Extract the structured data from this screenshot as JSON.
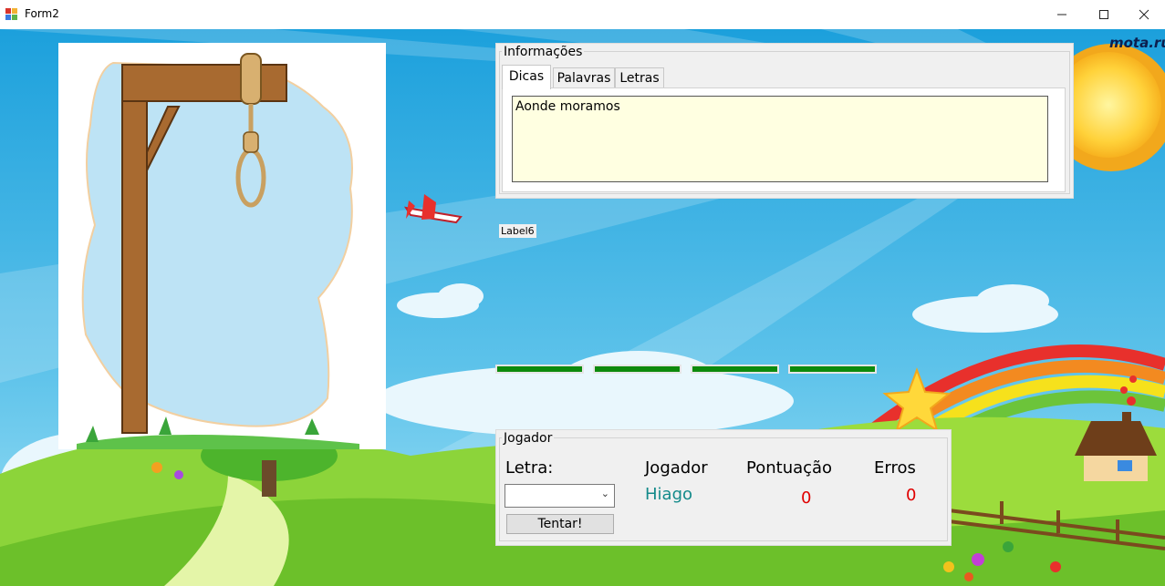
{
  "window": {
    "title": "Form2"
  },
  "watermark": "mota.ru",
  "info_group": {
    "legend": "Informações",
    "tabs": [
      {
        "label": "Dicas",
        "active": true
      },
      {
        "label": "Palavras",
        "active": false
      },
      {
        "label": "Letras",
        "active": false
      }
    ],
    "hint_text": "Aonde moramos"
  },
  "label6": "Label6",
  "word_slots": 4,
  "player_group": {
    "legend": "Jogador",
    "letter_label": "Letra:",
    "letter_value": "",
    "try_button": "Tentar!",
    "headers": {
      "player": "Jogador",
      "score": "Pontuação",
      "errors": "Erros"
    },
    "player_name": "Hiago",
    "score": "0",
    "errors": "0"
  },
  "colors": {
    "hint_bg": "#ffffe1",
    "slot_green": "#0d8a0d",
    "player_name": "#138a8a",
    "score_red": "#e00000"
  }
}
